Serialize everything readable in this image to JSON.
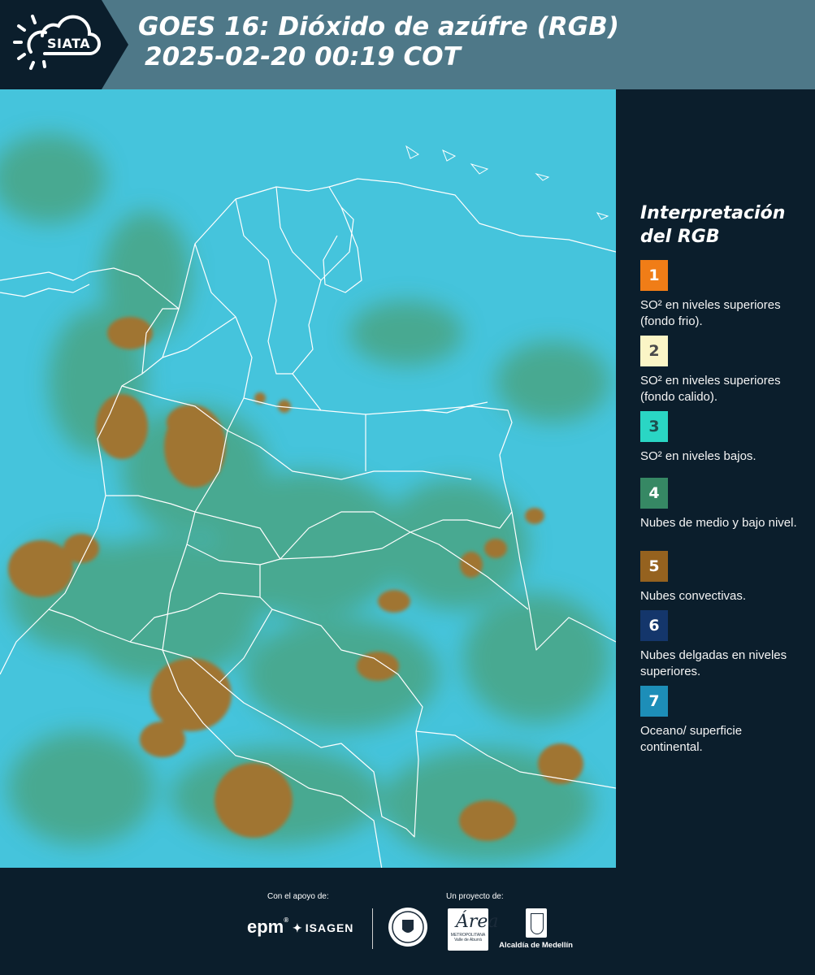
{
  "header": {
    "logo_text": "SIATA",
    "title_line1": "GOES 16: Dióxido de azúfre (RGB)",
    "title_line2": "2025-02-20 00:19 COT"
  },
  "legend": {
    "title_line1": "Interpretación",
    "title_line2": "del RGB",
    "items": [
      {
        "number": "1",
        "color": "#f07d17",
        "text_color": "#ffffff",
        "label": "SO² en niveles superiores (fondo frio)."
      },
      {
        "number": "2",
        "color": "#fbf5c6",
        "text_color": "#4a4a4a",
        "label": "SO² en niveles superiores (fondo calido)."
      },
      {
        "number": "3",
        "color": "#2ad6c4",
        "text_color": "#1d4f4f",
        "label": "SO² en niveles bajos."
      },
      {
        "number": "4",
        "color": "#368864",
        "text_color": "#ffffff",
        "label": "Nubes de medio y bajo nivel."
      },
      {
        "number": "5",
        "color": "#95621f",
        "text_color": "#ffffff",
        "label": "Nubes convectivas."
      },
      {
        "number": "6",
        "color": "#14366b",
        "text_color": "#ffffff",
        "label": "Nubes delgadas en niveles superiores."
      },
      {
        "number": "7",
        "color": "#1d8eb8",
        "text_color": "#ffffff",
        "label": "Oceano/ superficie continental."
      }
    ]
  },
  "map": {
    "background_color": "#45c4dc",
    "convective_color": "#a07530",
    "midlevel_color": "#4aa078",
    "border_color": "#ffffff"
  },
  "footer": {
    "support_label": "Con el apoyo de:",
    "project_label": "Un proyecto de:",
    "epm_text": "epm",
    "epm_mark": "®",
    "isagen_text": "ISAGEN",
    "area_text": "Área",
    "area_subtext": "METROPOLITANA Valle de Aburrá",
    "alcaldia_text": "Alcaldía de Medellín"
  }
}
